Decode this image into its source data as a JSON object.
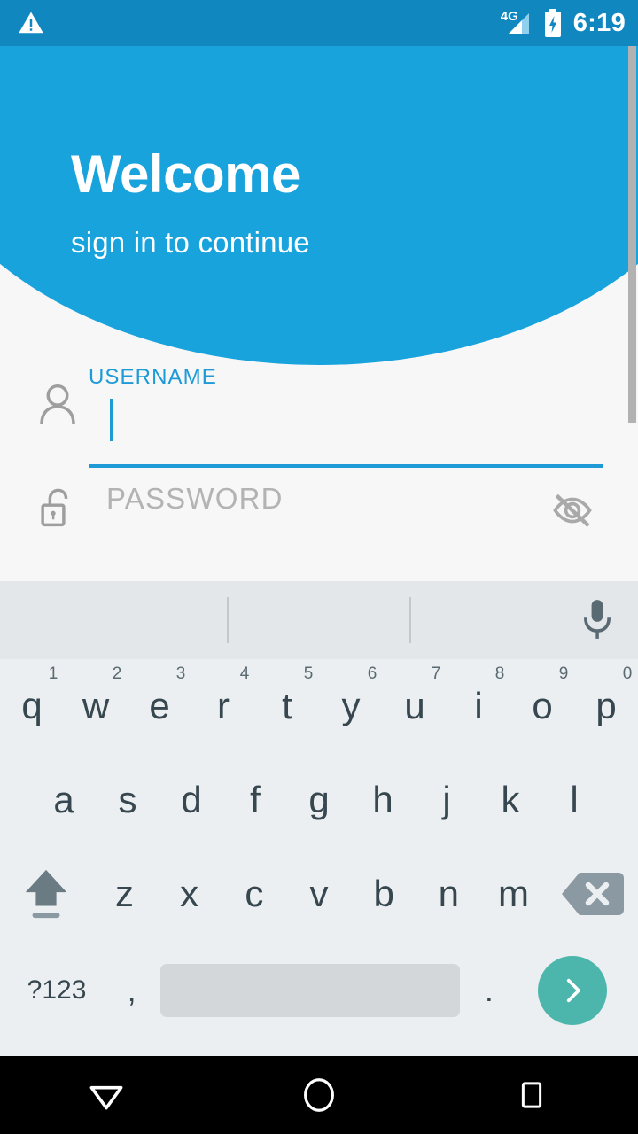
{
  "status_bar": {
    "warning_icon": "warning-triangle-icon",
    "network_type": "4G",
    "signal_icon": "signal-bars-icon",
    "battery_icon": "battery-charging-icon",
    "time": "6:19",
    "background_color": "#1187c0"
  },
  "header": {
    "title": "Welcome",
    "subtitle": "sign in to continue",
    "background_color": "#18a3dd",
    "text_color": "#ffffff"
  },
  "form": {
    "username": {
      "icon": "person-icon",
      "label": "USERNAME",
      "value": "",
      "focused": true,
      "accent_color": "#1e9ad6"
    },
    "password": {
      "icon": "unlocked-padlock-icon",
      "placeholder": "PASSWORD",
      "value": "",
      "toggle_icon": "eye-off-icon",
      "placeholder_color": "#b3b3b3"
    }
  },
  "scrollbar": {
    "thumb_color": "#b2b2b2",
    "visible": true
  },
  "keyboard": {
    "suggestion_bar": {
      "suggestions": [
        "",
        "",
        ""
      ],
      "mic_icon": "microphone-icon",
      "background_color": "#e4e7e9"
    },
    "background_color": "#eceff1",
    "row1": [
      {
        "key": "q",
        "num": "1"
      },
      {
        "key": "w",
        "num": "2"
      },
      {
        "key": "e",
        "num": "3"
      },
      {
        "key": "r",
        "num": "4"
      },
      {
        "key": "t",
        "num": "5"
      },
      {
        "key": "y",
        "num": "6"
      },
      {
        "key": "u",
        "num": "7"
      },
      {
        "key": "i",
        "num": "8"
      },
      {
        "key": "o",
        "num": "9"
      },
      {
        "key": "p",
        "num": "0"
      }
    ],
    "row2": [
      "a",
      "s",
      "d",
      "f",
      "g",
      "h",
      "j",
      "k",
      "l"
    ],
    "row3": {
      "shift_icon": "shift-arrow-icon",
      "keys": [
        "z",
        "x",
        "c",
        "v",
        "b",
        "n",
        "m"
      ],
      "delete_icon": "backspace-icon"
    },
    "row4": {
      "symbols_label": "?123",
      "comma": ",",
      "space": "",
      "period": ".",
      "enter_icon": "chevron-right-icon",
      "enter_color": "#4db6ac"
    }
  },
  "navbar": {
    "back_icon": "collapse-keyboard-down-arrow-icon",
    "home_icon": "home-circle-icon",
    "recents_icon": "recents-square-icon",
    "background_color": "#000000"
  }
}
